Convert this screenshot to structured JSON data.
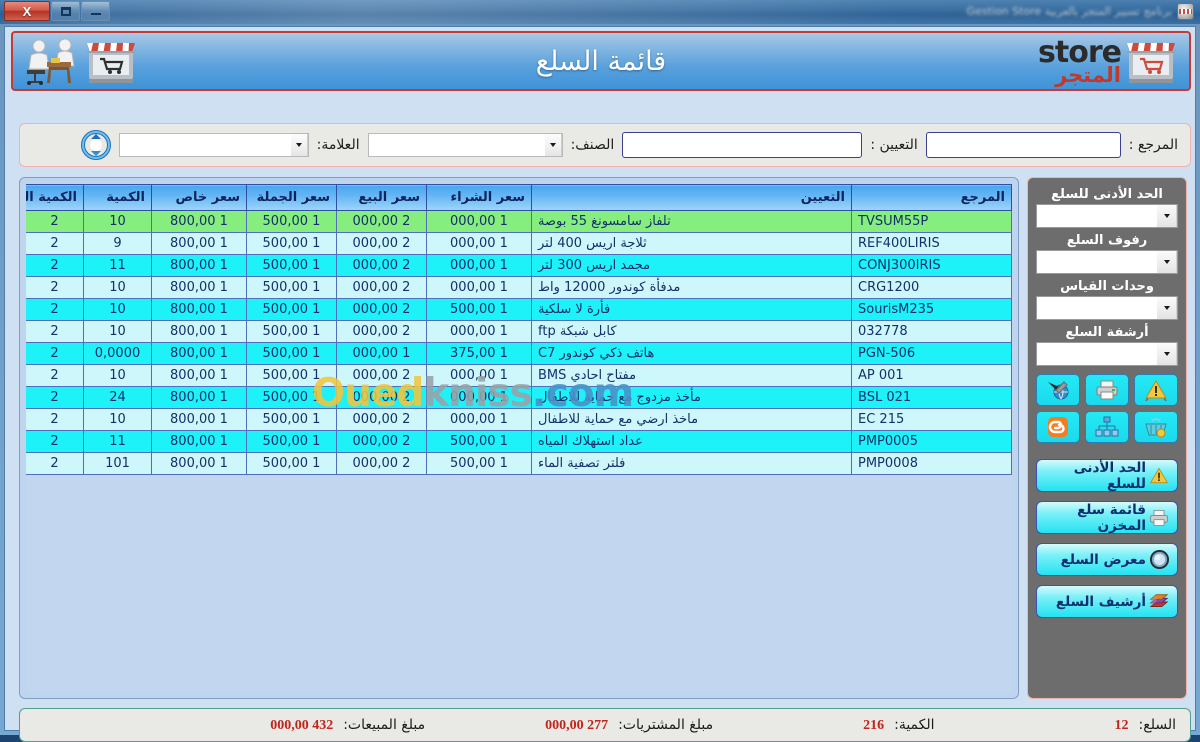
{
  "window": {
    "title": "برنامج تسيير المتجر بالعربية Gestion Store",
    "controls": {
      "minimize": "–",
      "maximize": "□",
      "close": "X"
    }
  },
  "header": {
    "title": "قائمة السلع",
    "brand_en": "store",
    "brand_ar": "المتجر",
    "logo_icon": "storefront-icon",
    "right_icons": [
      "storefront-icon",
      "office-desk-icon"
    ]
  },
  "filterbar": {
    "refresh_icon": "refresh-icon",
    "fields": [
      {
        "label": "المرجع :",
        "value": "",
        "type": "text"
      },
      {
        "label": "التعيين :",
        "value": "",
        "type": "text"
      },
      {
        "label": "الصنف:",
        "value": "",
        "type": "combo"
      },
      {
        "label": "العلامة:",
        "value": "",
        "type": "combo"
      }
    ]
  },
  "table": {
    "columns": [
      "المرجع",
      "التعيين",
      "سعر الشراء",
      "سعر البيع",
      "سعر الجملة",
      "سعر خاص",
      "الكمية",
      "الكمية الدنيا"
    ],
    "rows": [
      {
        "ref": "TVSUM55P",
        "des": "تلفاز سامسونغ 55 بوصة",
        "buy": "1 000,00",
        "sell": "2 000,00",
        "whole": "1 500,00",
        "special": "1 800,00",
        "qty": "10",
        "minqty": "2",
        "style": "sel"
      },
      {
        "ref": "REF400LIRIS",
        "des": "ثلاجة اريس 400 لتر",
        "buy": "1 000,00",
        "sell": "2 000,00",
        "whole": "1 500,00",
        "special": "1 800,00",
        "qty": "9",
        "minqty": "2",
        "style": "even"
      },
      {
        "ref": "CONJ300IRIS",
        "des": "مجمد اريس 300 لتر",
        "buy": "1 000,00",
        "sell": "2 000,00",
        "whole": "1 500,00",
        "special": "1 800,00",
        "qty": "11",
        "minqty": "2",
        "style": "odd"
      },
      {
        "ref": "CRG1200",
        "des": "مدفأة كوندور 12000 واط",
        "buy": "1 000,00",
        "sell": "2 000,00",
        "whole": "1 500,00",
        "special": "1 800,00",
        "qty": "10",
        "minqty": "2",
        "style": "even"
      },
      {
        "ref": "SourisM235",
        "des": "فأرة لا سلكية",
        "buy": "1 500,00",
        "sell": "2 000,00",
        "whole": "1 500,00",
        "special": "1 800,00",
        "qty": "10",
        "minqty": "2",
        "style": "odd"
      },
      {
        "ref": "032778",
        "des": "كابل شبكة ftp",
        "buy": "1 000,00",
        "sell": "2 000,00",
        "whole": "1 500,00",
        "special": "1 800,00",
        "qty": "10",
        "minqty": "2",
        "style": "even"
      },
      {
        "ref": "PGN-506",
        "des": "هاتف ذكي كوندور C7",
        "buy": "1 375,00",
        "sell": "1 000,00",
        "whole": "1 500,00",
        "special": "1 800,00",
        "qty": "0,0000",
        "minqty": "2",
        "style": "odd"
      },
      {
        "ref": "AP 001",
        "des": "مفتاح احادي BMS",
        "buy": "1 000,00",
        "sell": "2 000,00",
        "whole": "1 500,00",
        "special": "1 800,00",
        "qty": "10",
        "minqty": "2",
        "style": "even"
      },
      {
        "ref": "BSL 021",
        "des": "مأخذ مزدوج مع حماية للاطفال",
        "buy": "1 000,00",
        "sell": "2 000,00",
        "whole": "1 500,00",
        "special": "1 800,00",
        "qty": "24",
        "minqty": "2",
        "style": "odd"
      },
      {
        "ref": "EC 215",
        "des": "ماخذ ارضي مع حماية للاطفال",
        "buy": "1 000,00",
        "sell": "2 000,00",
        "whole": "1 500,00",
        "special": "1 800,00",
        "qty": "10",
        "minqty": "2",
        "style": "even"
      },
      {
        "ref": "PMP0005",
        "des": "عداد استهلاك المياه",
        "buy": "1 500,00",
        "sell": "2 000,00",
        "whole": "1 500,00",
        "special": "1 800,00",
        "qty": "11",
        "minqty": "2",
        "style": "odd"
      },
      {
        "ref": "PMP0008",
        "des": "فلتر تصفية الماء",
        "buy": "1 500,00",
        "sell": "2 000,00",
        "whole": "1 500,00",
        "special": "1 800,00",
        "qty": "101",
        "minqty": "2",
        "style": "even"
      }
    ]
  },
  "watermark": {
    "part1": "Oued",
    "part2": "kniss",
    "part3": ".com"
  },
  "sidebar": {
    "combos": [
      {
        "label": "الحد الأدنى للسلع",
        "value": ""
      },
      {
        "label": "رفوف السلع",
        "value": ""
      },
      {
        "label": "وحدات القياس",
        "value": ""
      },
      {
        "label": "أرشفة السلع",
        "value": ""
      }
    ],
    "icon_buttons": [
      {
        "icon": "alert-warning-icon"
      },
      {
        "icon": "printer-icon"
      },
      {
        "icon": "tools-globe-icon"
      },
      {
        "icon": "basket-icon"
      },
      {
        "icon": "hierarchy-icon"
      },
      {
        "icon": "blogger-icon"
      }
    ],
    "buttons": [
      {
        "label": "الحد الأدنى للسلع",
        "icon": "alert-warning-icon"
      },
      {
        "label": "قائمة سلع المخزن",
        "icon": "printer-icon"
      },
      {
        "label": "معرض السلع",
        "icon": "gallery-circle-icon"
      },
      {
        "label": "أرشيف السلع",
        "icon": "books-icon"
      }
    ]
  },
  "statusbar": {
    "items": [
      {
        "label": "السلع:",
        "value": "12"
      },
      {
        "label": "الكمية:",
        "value": "216"
      },
      {
        "label": "مبلغ المشتريات:",
        "value": "277 000,00"
      },
      {
        "label": "مبلغ المبيعات:",
        "value": "432 000,00"
      }
    ]
  },
  "colors": {
    "accent_red": "#c23b36",
    "header_blue": "#3f93d8",
    "row_selected": "#86ee7e",
    "row_odd": "#1cf2f8",
    "row_even": "#cdf7fb",
    "status_value": "#c0261c"
  }
}
